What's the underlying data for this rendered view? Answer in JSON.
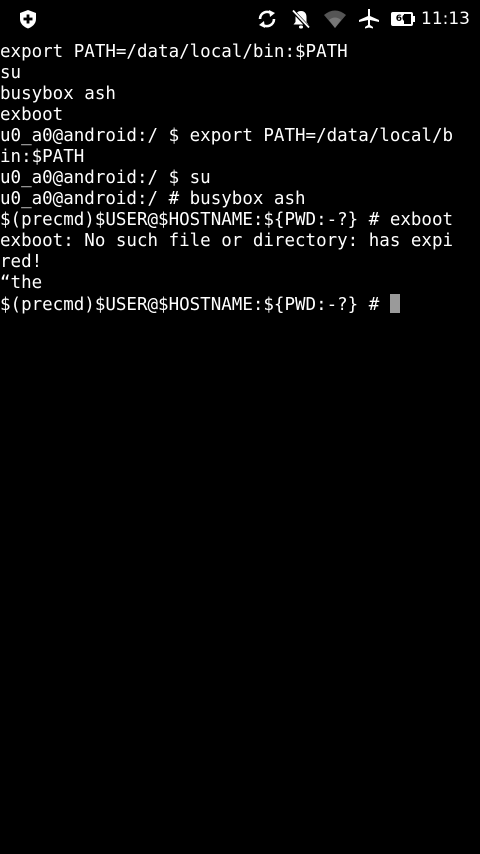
{
  "status_bar": {
    "left_icon": "shield-plus-icon",
    "right_icons": [
      "sync-icon",
      "notifications-muted-icon",
      "wifi-icon",
      "airplane-mode-icon"
    ],
    "battery_level": 60,
    "battery_text": "60",
    "time": "11:13"
  },
  "terminal": {
    "lines": [
      "export PATH=/data/local/bin:$PATH",
      "su",
      "busybox ash",
      "exboot",
      "u0_a0@android:/ $ export PATH=/data/local/b",
      "in:$PATH",
      "u0_a0@android:/ $ su",
      "u0_a0@android:/ # busybox ash",
      "$(precmd)$USER@$HOSTNAME:${PWD:-?} # exboot",
      "exboot: No such file or directory: has expi",
      "red!",
      "“the"
    ],
    "prompt": "$(precmd)$USER@$HOSTNAME:${PWD:-?} # "
  }
}
